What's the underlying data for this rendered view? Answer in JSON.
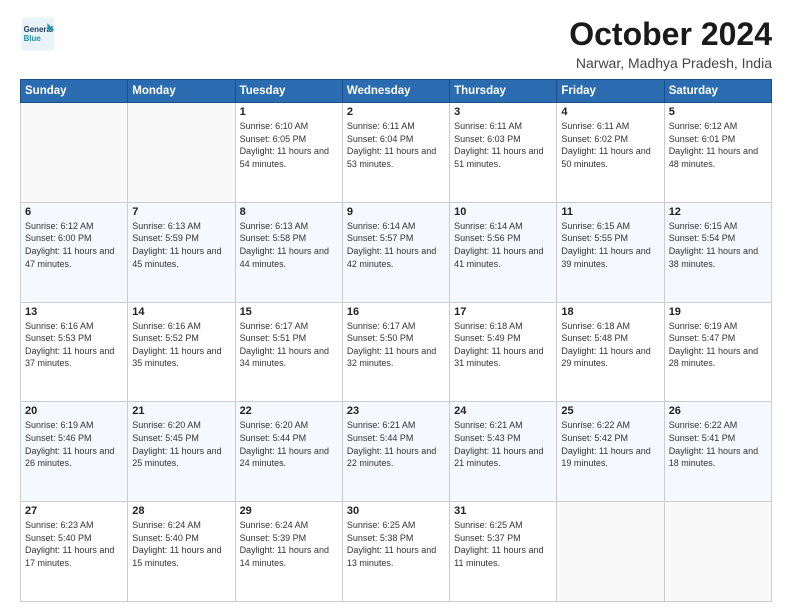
{
  "header": {
    "logo_line1": "General",
    "logo_line2": "Blue",
    "month": "October 2024",
    "location": "Narwar, Madhya Pradesh, India"
  },
  "weekdays": [
    "Sunday",
    "Monday",
    "Tuesday",
    "Wednesday",
    "Thursday",
    "Friday",
    "Saturday"
  ],
  "weeks": [
    [
      {
        "day": "",
        "text": ""
      },
      {
        "day": "",
        "text": ""
      },
      {
        "day": "1",
        "text": "Sunrise: 6:10 AM\nSunset: 6:05 PM\nDaylight: 11 hours and 54 minutes."
      },
      {
        "day": "2",
        "text": "Sunrise: 6:11 AM\nSunset: 6:04 PM\nDaylight: 11 hours and 53 minutes."
      },
      {
        "day": "3",
        "text": "Sunrise: 6:11 AM\nSunset: 6:03 PM\nDaylight: 11 hours and 51 minutes."
      },
      {
        "day": "4",
        "text": "Sunrise: 6:11 AM\nSunset: 6:02 PM\nDaylight: 11 hours and 50 minutes."
      },
      {
        "day": "5",
        "text": "Sunrise: 6:12 AM\nSunset: 6:01 PM\nDaylight: 11 hours and 48 minutes."
      }
    ],
    [
      {
        "day": "6",
        "text": "Sunrise: 6:12 AM\nSunset: 6:00 PM\nDaylight: 11 hours and 47 minutes."
      },
      {
        "day": "7",
        "text": "Sunrise: 6:13 AM\nSunset: 5:59 PM\nDaylight: 11 hours and 45 minutes."
      },
      {
        "day": "8",
        "text": "Sunrise: 6:13 AM\nSunset: 5:58 PM\nDaylight: 11 hours and 44 minutes."
      },
      {
        "day": "9",
        "text": "Sunrise: 6:14 AM\nSunset: 5:57 PM\nDaylight: 11 hours and 42 minutes."
      },
      {
        "day": "10",
        "text": "Sunrise: 6:14 AM\nSunset: 5:56 PM\nDaylight: 11 hours and 41 minutes."
      },
      {
        "day": "11",
        "text": "Sunrise: 6:15 AM\nSunset: 5:55 PM\nDaylight: 11 hours and 39 minutes."
      },
      {
        "day": "12",
        "text": "Sunrise: 6:15 AM\nSunset: 5:54 PM\nDaylight: 11 hours and 38 minutes."
      }
    ],
    [
      {
        "day": "13",
        "text": "Sunrise: 6:16 AM\nSunset: 5:53 PM\nDaylight: 11 hours and 37 minutes."
      },
      {
        "day": "14",
        "text": "Sunrise: 6:16 AM\nSunset: 5:52 PM\nDaylight: 11 hours and 35 minutes."
      },
      {
        "day": "15",
        "text": "Sunrise: 6:17 AM\nSunset: 5:51 PM\nDaylight: 11 hours and 34 minutes."
      },
      {
        "day": "16",
        "text": "Sunrise: 6:17 AM\nSunset: 5:50 PM\nDaylight: 11 hours and 32 minutes."
      },
      {
        "day": "17",
        "text": "Sunrise: 6:18 AM\nSunset: 5:49 PM\nDaylight: 11 hours and 31 minutes."
      },
      {
        "day": "18",
        "text": "Sunrise: 6:18 AM\nSunset: 5:48 PM\nDaylight: 11 hours and 29 minutes."
      },
      {
        "day": "19",
        "text": "Sunrise: 6:19 AM\nSunset: 5:47 PM\nDaylight: 11 hours and 28 minutes."
      }
    ],
    [
      {
        "day": "20",
        "text": "Sunrise: 6:19 AM\nSunset: 5:46 PM\nDaylight: 11 hours and 26 minutes."
      },
      {
        "day": "21",
        "text": "Sunrise: 6:20 AM\nSunset: 5:45 PM\nDaylight: 11 hours and 25 minutes."
      },
      {
        "day": "22",
        "text": "Sunrise: 6:20 AM\nSunset: 5:44 PM\nDaylight: 11 hours and 24 minutes."
      },
      {
        "day": "23",
        "text": "Sunrise: 6:21 AM\nSunset: 5:44 PM\nDaylight: 11 hours and 22 minutes."
      },
      {
        "day": "24",
        "text": "Sunrise: 6:21 AM\nSunset: 5:43 PM\nDaylight: 11 hours and 21 minutes."
      },
      {
        "day": "25",
        "text": "Sunrise: 6:22 AM\nSunset: 5:42 PM\nDaylight: 11 hours and 19 minutes."
      },
      {
        "day": "26",
        "text": "Sunrise: 6:22 AM\nSunset: 5:41 PM\nDaylight: 11 hours and 18 minutes."
      }
    ],
    [
      {
        "day": "27",
        "text": "Sunrise: 6:23 AM\nSunset: 5:40 PM\nDaylight: 11 hours and 17 minutes."
      },
      {
        "day": "28",
        "text": "Sunrise: 6:24 AM\nSunset: 5:40 PM\nDaylight: 11 hours and 15 minutes."
      },
      {
        "day": "29",
        "text": "Sunrise: 6:24 AM\nSunset: 5:39 PM\nDaylight: 11 hours and 14 minutes."
      },
      {
        "day": "30",
        "text": "Sunrise: 6:25 AM\nSunset: 5:38 PM\nDaylight: 11 hours and 13 minutes."
      },
      {
        "day": "31",
        "text": "Sunrise: 6:25 AM\nSunset: 5:37 PM\nDaylight: 11 hours and 11 minutes."
      },
      {
        "day": "",
        "text": ""
      },
      {
        "day": "",
        "text": ""
      }
    ]
  ]
}
